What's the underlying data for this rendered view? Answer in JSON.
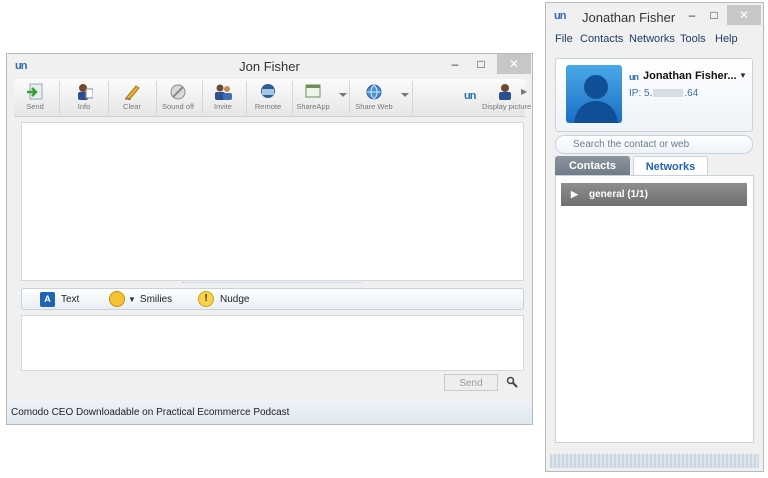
{
  "chat_window": {
    "title": "Jon Fisher",
    "logo": "un",
    "controls": {
      "minimize": "–",
      "maximize": "□",
      "close": "✕"
    },
    "toolbar": [
      {
        "label": "Send",
        "icon": "send-file-icon"
      },
      {
        "label": "Info",
        "icon": "info-icon"
      },
      {
        "label": "Clear",
        "icon": "clear-icon"
      },
      {
        "label": "Sound off",
        "icon": "sound-off-icon"
      },
      {
        "label": "Invite",
        "icon": "invite-icon"
      },
      {
        "label": "Remote",
        "icon": "remote-icon"
      },
      {
        "label": "ShareApp",
        "icon": "share-app-icon"
      },
      {
        "label": "Share Web",
        "icon": "share-web-icon"
      },
      {
        "label": "Display picture",
        "icon": "display-picture-icon"
      }
    ],
    "format_bar": {
      "text_badge": "A",
      "text_label": "Text",
      "smilies_label": "Smilies",
      "nudge_label": "Nudge"
    },
    "send_button": "Send",
    "status_text": "Comodo CEO Downloadable on Practical Ecommerce Podcast",
    "colors": {
      "accent": "#1f63b6",
      "brand_green": "#7ab648"
    }
  },
  "contacts_window": {
    "title": "Jonathan Fisher",
    "logo": "un",
    "controls": {
      "minimize": "–",
      "maximize": "□",
      "close": "✕"
    },
    "menu": [
      "File",
      "Contacts",
      "Networks",
      "Tools",
      "Help"
    ],
    "profile": {
      "name": "Jonathan Fisher...",
      "ip_label": "IP: 5.",
      "ip_suffix": ".64"
    },
    "search_placeholder": "Search the contact or web",
    "tabs": [
      "Contacts",
      "Networks"
    ],
    "active_tab": "Contacts",
    "groups": [
      {
        "label": "general (1/1)"
      }
    ],
    "colors": {
      "tab_active": "#7a8591",
      "tab_text": "#1f63b6"
    }
  }
}
